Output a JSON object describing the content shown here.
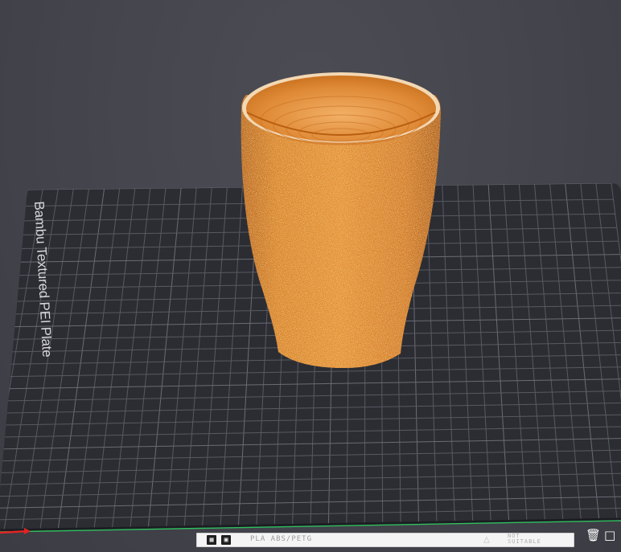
{
  "plate": {
    "label": "Bambu Textured PEI Plate"
  },
  "model": {
    "name": "cup",
    "color": "#d07418"
  },
  "bottom_bar": {
    "filament_text": "PLA ABS/PETG",
    "warning_text": "NOT\nSUITABLE"
  },
  "icons": {
    "plate_type": "plate-type-icon",
    "plate_settings": "plate-settings-icon",
    "warning": "warning-icon",
    "trash": "trash-icon",
    "plate_box": "plate-box-icon"
  },
  "colors": {
    "background": "#45454d",
    "plate": "#2d2e34",
    "grid": "#5a5c64",
    "model": "#d07418",
    "x_axis": "#e02020",
    "y_axis": "#20c060"
  }
}
